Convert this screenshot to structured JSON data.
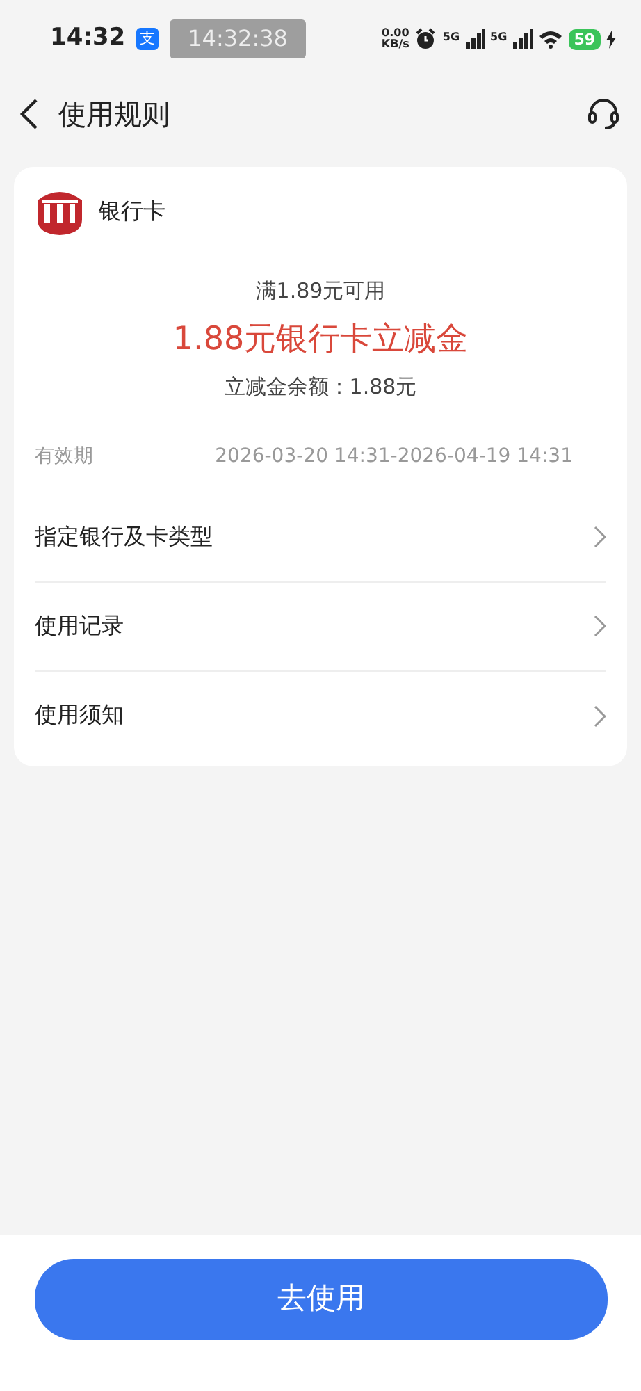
{
  "status_bar": {
    "time": "14:32",
    "app_badge": "支",
    "recording": "14:32:38",
    "net_speed": [
      "0.00",
      "KB/s"
    ],
    "networks": [
      "5G",
      "5G"
    ],
    "battery": "59"
  },
  "header": {
    "title": "使用规则"
  },
  "card": {
    "bank_label": "银行卡",
    "condition": "满1.89元可用",
    "amount": "1.88元银行卡立减金",
    "balance": "立减金余额：1.88元",
    "validity_label": "有效期",
    "validity": "2026-03-20 14:31-2026-04-19 14:31",
    "rows": [
      {
        "label": "指定银行及卡类型"
      },
      {
        "label": "使用记录"
      },
      {
        "label": "使用须知"
      }
    ]
  },
  "action": {
    "label": "去使用"
  }
}
